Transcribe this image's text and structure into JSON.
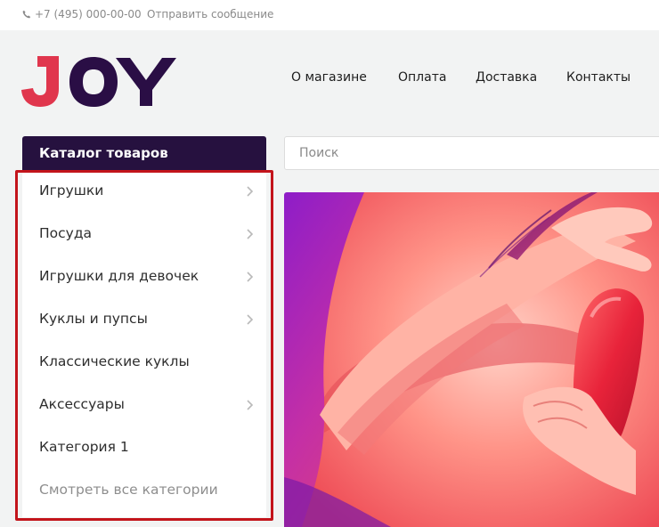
{
  "topbar": {
    "phone_icon": "phone-icon",
    "phone": "+7 (495) 000-00-00",
    "message_link": "Отправить сообщение"
  },
  "logo": {
    "text": "JOY",
    "color_j": "#e0364d",
    "color_oy": "#2a0e45"
  },
  "nav": {
    "items": [
      {
        "label": "О магазине"
      },
      {
        "label": "Оплата"
      },
      {
        "label": "Доставка"
      },
      {
        "label": "Контакты"
      }
    ]
  },
  "catalog": {
    "title": "Каталог товаров",
    "items": [
      {
        "label": "Игрушки",
        "has_submenu": true
      },
      {
        "label": "Посуда",
        "has_submenu": true
      },
      {
        "label": "Игрушки для девочек",
        "has_submenu": true
      },
      {
        "label": "Куклы и пупсы",
        "has_submenu": true
      },
      {
        "label": "Классические куклы",
        "has_submenu": false
      },
      {
        "label": "Аксессуары",
        "has_submenu": true
      },
      {
        "label": "Категория 1",
        "has_submenu": false
      },
      {
        "label": "Смотреть все категории",
        "has_submenu": false
      }
    ],
    "chevron_icon": "chevron-right-icon",
    "highlight_color": "#c3141b"
  },
  "search": {
    "placeholder": "Поиск",
    "value": ""
  },
  "colors": {
    "header_bg": "#26113f",
    "page_bg": "#f2f3f3",
    "banner_purple": "#8a1cc0",
    "banner_pink": "#ff6b6b"
  }
}
